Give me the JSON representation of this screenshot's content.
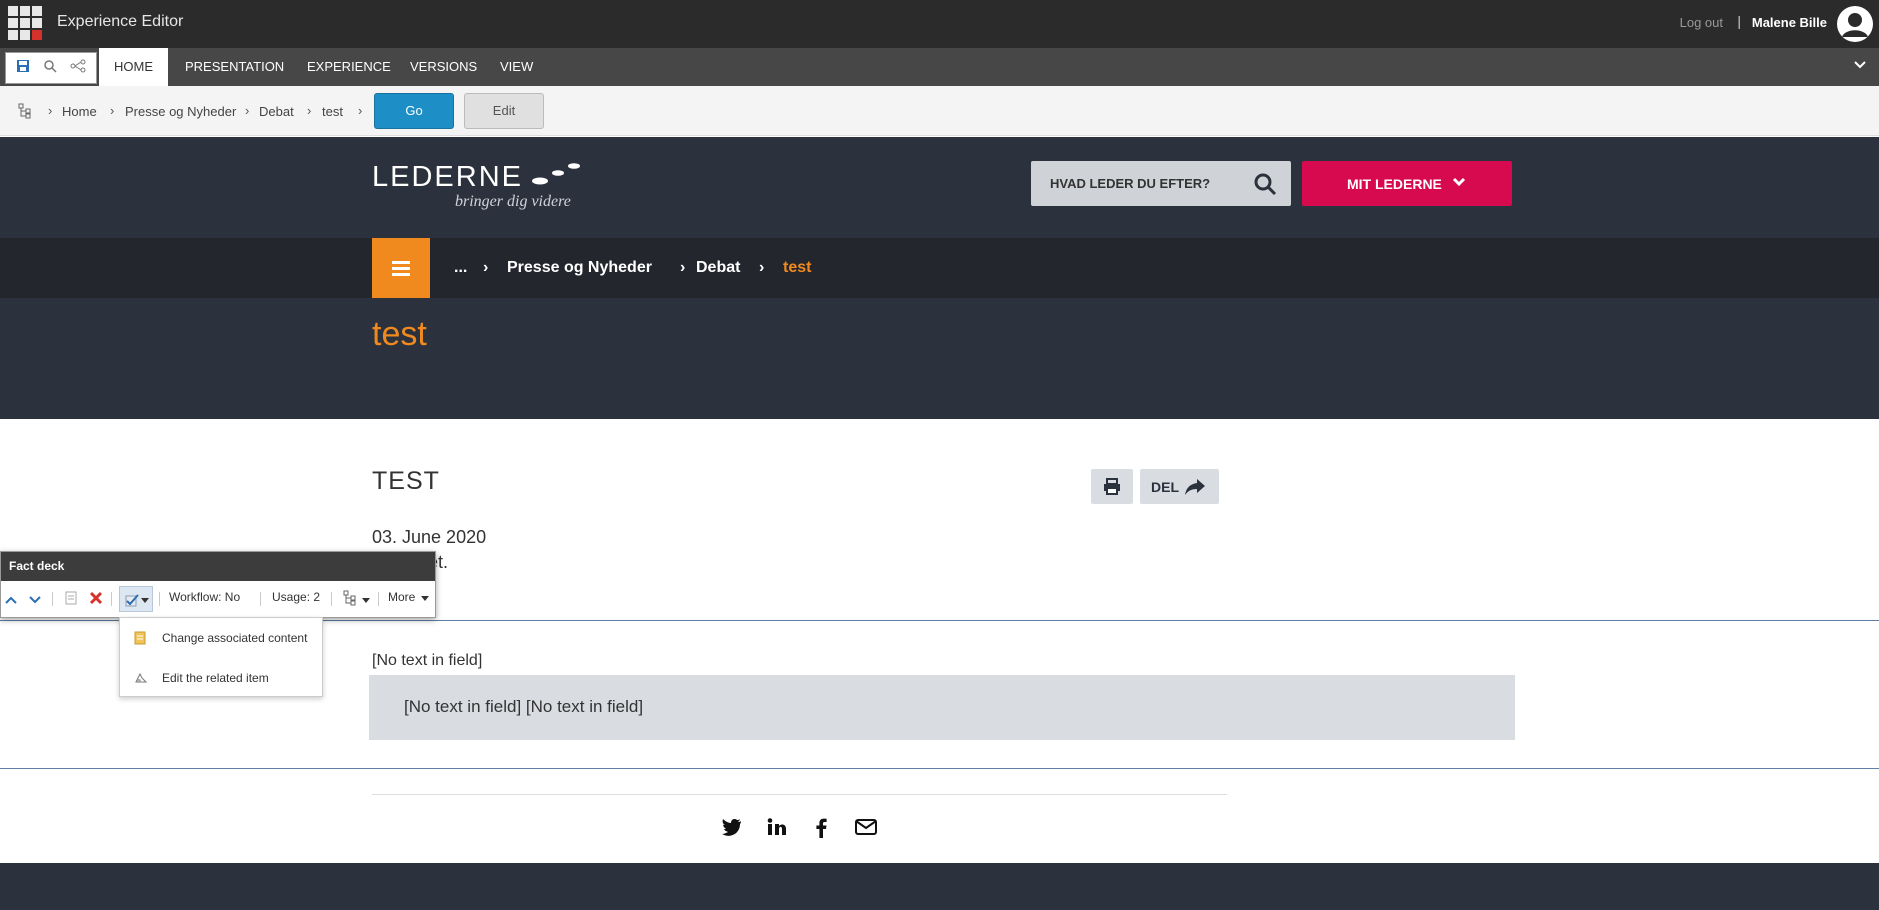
{
  "topbar": {
    "app_title": "Experience Editor",
    "logout": "Log out",
    "separator": "|",
    "username": "Malene Bille"
  },
  "ribbon": {
    "tabs": [
      "HOME",
      "PRESENTATION",
      "EXPERIENCE",
      "VERSIONS",
      "VIEW"
    ],
    "active_tab": "HOME"
  },
  "breadcrumb": {
    "items": [
      "Home",
      "Presse og Nyheder",
      "Debat",
      "test"
    ],
    "go": "Go",
    "edit": "Edit"
  },
  "site": {
    "logo_text": "LEDERNE",
    "logo_tagline": "bringer dig videre",
    "search_placeholder": "HVAD LEDER DU EFTER?",
    "mit_button": "MIT LEDERNE",
    "nav_crumbs": [
      "...",
      "Presse og Nyheder",
      "Debat",
      "test"
    ],
    "page_heading": "test",
    "accent_color": "#f08a1f",
    "brand_color": "#d7094f"
  },
  "article": {
    "title": "TEST",
    "del_button": "DEL",
    "date": "03. June 2020",
    "body": "et.",
    "no_text": "[No text in field]",
    "fact_text": "[No text in field] [No text in field]"
  },
  "fact_deck": {
    "title": "Fact deck",
    "workflow": "Workflow: No",
    "usage": "Usage: 2",
    "more": "More",
    "menu": [
      "Change associated content",
      "Edit the related item"
    ]
  }
}
